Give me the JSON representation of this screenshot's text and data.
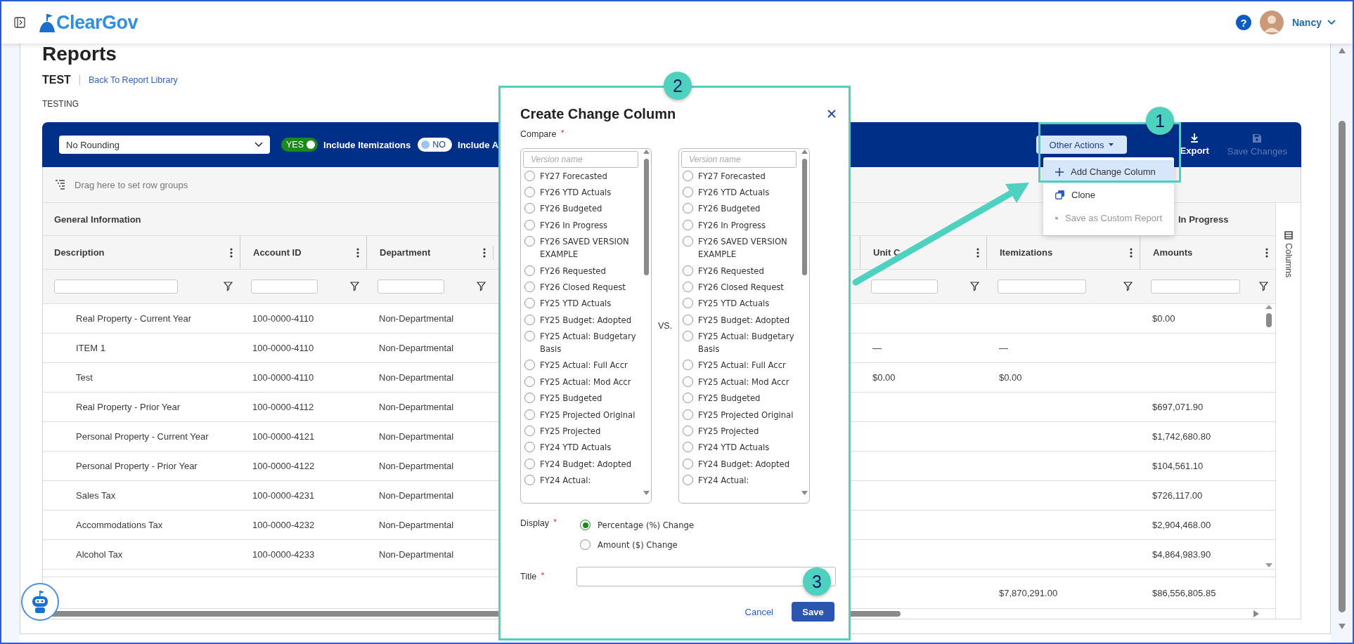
{
  "header": {
    "logo": "ClearGov",
    "help": "?",
    "user": "Nancy"
  },
  "page": {
    "title": "Reports",
    "report_name": "TEST",
    "back_link": "Back To Report Library",
    "description": "TESTING"
  },
  "toolbar": {
    "rounding": "No Rounding",
    "toggles": [
      {
        "text": "YES",
        "on": true,
        "label": "Include Itemizations"
      },
      {
        "text": "NO",
        "on": false,
        "label": "Include A"
      }
    ],
    "other_actions": "Other Actions",
    "export": "Export",
    "save_changes": {
      "label": "Save Changes",
      "disabled": true
    }
  },
  "menu": [
    {
      "label": "Add Change Column",
      "kind": "add",
      "selected": true,
      "disabled": false
    },
    {
      "label": "Clone",
      "kind": "clone",
      "selected": false,
      "disabled": false
    },
    {
      "label": "Save as Custom Report",
      "kind": "save",
      "selected": false,
      "disabled": true
    }
  ],
  "table": {
    "row_groups_hint": "Drag here to set row groups",
    "groups": [
      "General Information",
      "In Progress"
    ],
    "columns": [
      "Description",
      "Account ID",
      "Department",
      "Unit C",
      "Itemizations",
      "Amounts"
    ],
    "rows": [
      {
        "description": "Real Property - Current Year",
        "account_id": "100-0000-4110",
        "department": "Non-Departmental",
        "amounts": "$0.00"
      },
      {
        "description": "ITEM 1",
        "account_id": "100-0000-4110",
        "department": "Non-Departmental",
        "column_4": "—",
        "itemizations": "—"
      },
      {
        "description": "Test",
        "account_id": "100-0000-4110",
        "department": "Non-Departmental",
        "column_4": "$0.00",
        "itemizations": "$0.00"
      },
      {
        "description": "Real Property - Prior Year",
        "account_id": "100-0000-4112",
        "department": "Non-Departmental",
        "amounts": "$697,071.90"
      },
      {
        "description": "Personal Property - Current Year",
        "account_id": "100-0000-4121",
        "department": "Non-Departmental",
        "amounts": "$1,742,680.80"
      },
      {
        "description": "Personal Property - Prior Year",
        "account_id": "100-0000-4122",
        "department": "Non-Departmental",
        "amounts": "$104,561.10"
      },
      {
        "description": "Sales Tax",
        "account_id": "100-0000-4231",
        "department": "Non-Departmental",
        "amounts": "$726,117.00"
      },
      {
        "description": "Accommodations Tax",
        "account_id": "100-0000-4232",
        "department": "Non-Departmental",
        "amounts": "$2,904,468.00"
      },
      {
        "description": "Alcohol Tax",
        "account_id": "100-0000-4233",
        "department": "Non-Departmental",
        "amounts": "$4,864,983.90"
      }
    ],
    "totals": {
      "itemizations": "$7,870,291.00",
      "amounts": "$86,556,805.85"
    },
    "side_panel": "Columns"
  },
  "dialog": {
    "title": "Create Change Column",
    "compare": {
      "label": "Compare",
      "required_mark": "*"
    },
    "lists": [
      {
        "placeholder": "Version name",
        "options": [
          {
            "label": "FY27 Forecasted",
            "selected": false
          },
          {
            "label": "FY26 YTD Actuals",
            "selected": false
          },
          {
            "label": "FY26 Budgeted",
            "selected": false
          },
          {
            "label": "FY26 In Progress",
            "selected": false
          },
          {
            "label": "FY26 SAVED VERSION EXAMPLE",
            "selected": false
          },
          {
            "label": "FY26 Requested",
            "selected": false
          },
          {
            "label": "FY26 Closed Request",
            "selected": false
          },
          {
            "label": "FY25 YTD Actuals",
            "selected": false
          },
          {
            "label": "FY25 Budget: Adopted",
            "selected": false
          },
          {
            "label": "FY25 Actual: Budgetary Basis",
            "selected": false
          },
          {
            "label": "FY25 Actual: Full Accr",
            "selected": false
          },
          {
            "label": "FY25 Actual: Mod Accr",
            "selected": false
          },
          {
            "label": "FY25 Budgeted",
            "selected": false
          },
          {
            "label": "FY25 Projected Original",
            "selected": false
          },
          {
            "label": "FY25 Projected",
            "selected": false
          },
          {
            "label": "FY24 YTD Actuals",
            "selected": false
          },
          {
            "label": "FY24 Budget: Adopted",
            "selected": false
          },
          {
            "label": "FY24 Actual:",
            "selected": false
          }
        ]
      },
      {
        "placeholder": "Version name",
        "options": [
          {
            "label": "FY27 Forecasted",
            "selected": false
          },
          {
            "label": "FY26 YTD Actuals",
            "selected": false
          },
          {
            "label": "FY26 Budgeted",
            "selected": false
          },
          {
            "label": "FY26 In Progress",
            "selected": false
          },
          {
            "label": "FY26 SAVED VERSION EXAMPLE",
            "selected": false
          },
          {
            "label": "FY26 Requested",
            "selected": false
          },
          {
            "label": "FY26 Closed Request",
            "selected": false
          },
          {
            "label": "FY25 YTD Actuals",
            "selected": false
          },
          {
            "label": "FY25 Budget: Adopted",
            "selected": false
          },
          {
            "label": "FY25 Actual: Budgetary Basis",
            "selected": false
          },
          {
            "label": "FY25 Actual: Full Accr",
            "selected": false
          },
          {
            "label": "FY25 Actual: Mod Accr",
            "selected": false
          },
          {
            "label": "FY25 Budgeted",
            "selected": false
          },
          {
            "label": "FY25 Projected Original",
            "selected": false
          },
          {
            "label": "FY25 Projected",
            "selected": false
          },
          {
            "label": "FY24 YTD Actuals",
            "selected": false
          },
          {
            "label": "FY24 Budget: Adopted",
            "selected": false
          },
          {
            "label": "FY24 Actual:",
            "selected": false
          }
        ]
      }
    ],
    "vs": "VS.",
    "display": {
      "label": "Display",
      "required_mark": "*",
      "options": [
        {
          "label": "Percentage (%) Change",
          "selected": true
        },
        {
          "label": "Amount ($) Change",
          "selected": false
        }
      ]
    },
    "title_field": {
      "label": "Title",
      "required_mark": "*"
    },
    "cancel": "Cancel",
    "save": "Save"
  },
  "annotations": [
    {
      "number": "1"
    },
    {
      "number": "2"
    },
    {
      "number": "3"
    }
  ]
}
